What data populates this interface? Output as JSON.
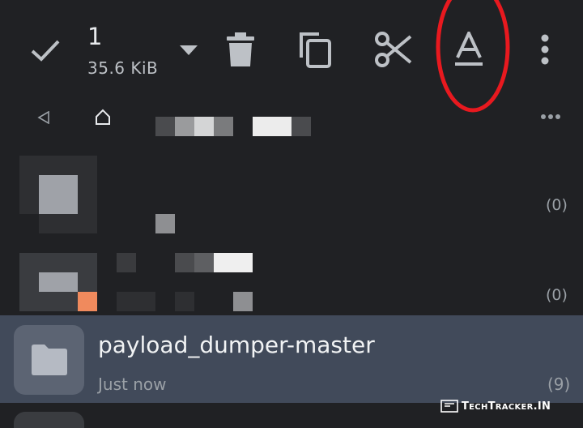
{
  "selection_bar": {
    "count": "1",
    "size": "35.6  KiB",
    "icons": [
      "check-icon",
      "dropdown-arrow-icon",
      "trash-icon",
      "copy-icon",
      "cut-icon",
      "rename-icon",
      "more-vertical-icon"
    ]
  },
  "breadcrumb": {
    "icons": [
      "back-arrow-icon",
      "home-icon",
      "more-horizontal-icon"
    ]
  },
  "files": [
    {
      "count": "(0)"
    },
    {
      "count": "(0)"
    },
    {
      "name": "payload_dumper-master",
      "time": "Just now",
      "count": "(9)",
      "selected": true
    }
  ],
  "watermark": {
    "prefix": "T",
    "small1": "ECH",
    "mid": "T",
    "small2": "RACKER",
    "suffix": ".IN"
  },
  "annotation_color": "#e8191f",
  "accent_color": "#414a5a"
}
